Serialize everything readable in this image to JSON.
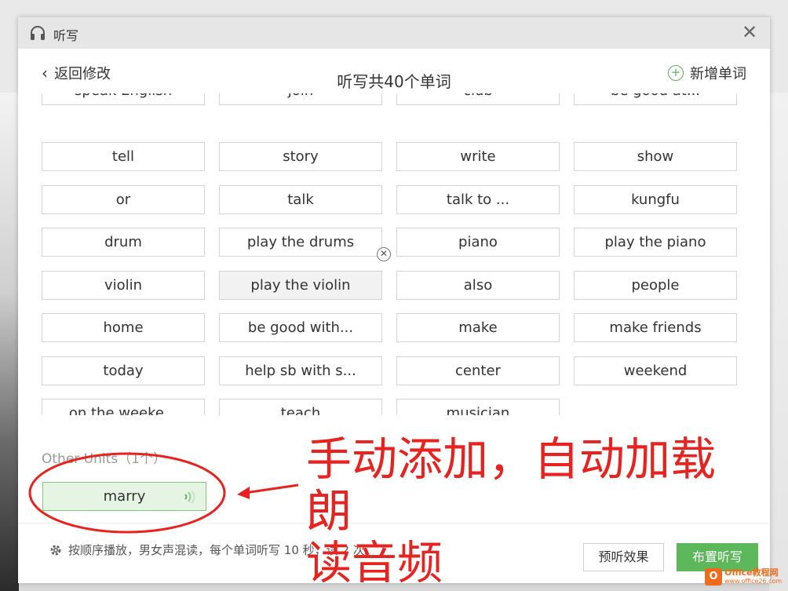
{
  "window": {
    "title": "听写"
  },
  "header": {
    "back_label": "返回修改",
    "title": "听写共40个单词",
    "add_label": "新增单词"
  },
  "words": [
    [
      "speak English",
      "join",
      "club",
      "be good at..."
    ],
    [
      "tell",
      "story",
      "write",
      "show"
    ],
    [
      "or",
      "talk",
      "talk to ...",
      "kungfu"
    ],
    [
      "drum",
      "play the drums",
      "piano",
      "play the piano"
    ],
    [
      "violin",
      "play the violin",
      "also",
      "people"
    ],
    [
      "home",
      "be good with...",
      "make",
      "make friends"
    ],
    [
      "today",
      "help sb with s...",
      "center",
      "weekend"
    ],
    [
      "on the weeke...",
      "teach",
      "musician"
    ]
  ],
  "other_units": {
    "label": "Other Units（1个）",
    "words": [
      "marry"
    ]
  },
  "footer": {
    "settings_text": "按顺序播放，男女声混读，每个单词听写 10 秒，读 2 次",
    "preview_label": "预听效果",
    "assign_label": "布置听写"
  },
  "annotation": {
    "line1": "手动添加，自动加载朗",
    "line2": "读音频"
  },
  "watermark": {
    "logo": "O",
    "brand": "Office教程网",
    "url": "www.office26.com"
  },
  "colors": {
    "accent_green": "#5db85c",
    "annotation_red": "#e8231f",
    "selected_bg": "#e6f4e4"
  }
}
